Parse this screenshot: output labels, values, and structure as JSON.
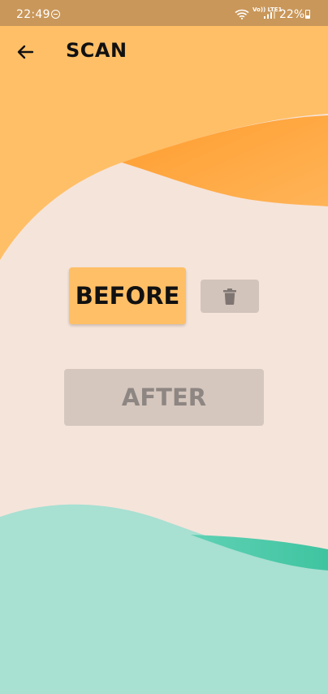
{
  "status_bar": {
    "time": "22:49",
    "network": "Vo)) LTE1",
    "battery": "22%"
  },
  "app_bar": {
    "title": "SCAN",
    "back_icon": "arrow-left"
  },
  "buttons": {
    "before_label": "BEFORE",
    "after_label": "AFTER",
    "delete_icon": "trash-can"
  },
  "colors": {
    "status_bar": "#c9975a",
    "orange_wave": "#ffbf66",
    "background": "#f5e4da",
    "teal_wave": "#a8e0d2",
    "before_button": "#ffbf66",
    "disabled_button": "#d5c7be"
  }
}
